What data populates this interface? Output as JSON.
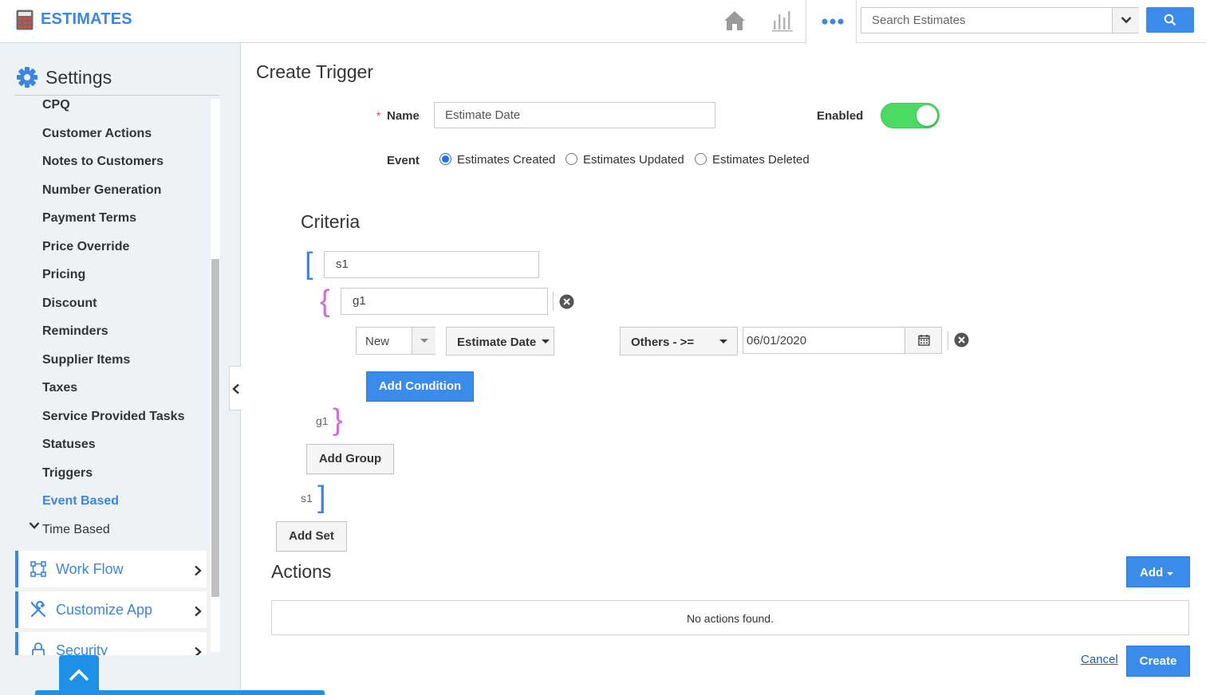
{
  "header": {
    "app_title": "ESTIMATES",
    "search_placeholder": "Search Estimates",
    "icons": [
      "calculator-icon",
      "home-icon",
      "bar-chart-icon",
      "more-dots-icon",
      "chevron-down-icon",
      "search-icon"
    ]
  },
  "colors": {
    "accent": "#3b86e0",
    "primary_button": "#3b8beb",
    "toggle_on": "#4cd964",
    "group_bracket": "#cf6fd6",
    "required": "#e04a3b"
  },
  "sidebar": {
    "title": "Settings",
    "items": [
      {
        "label": "CPQ"
      },
      {
        "label": "Customer Actions"
      },
      {
        "label": "Notes to Customers"
      },
      {
        "label": "Number Generation"
      },
      {
        "label": "Payment Terms"
      },
      {
        "label": "Price Override"
      },
      {
        "label": "Pricing"
      },
      {
        "label": "Discount"
      },
      {
        "label": "Reminders"
      },
      {
        "label": "Supplier Items"
      },
      {
        "label": "Taxes"
      },
      {
        "label": "Service Provided Tasks"
      },
      {
        "label": "Statuses"
      },
      {
        "label": "Triggers"
      },
      {
        "label": "Event Based"
      },
      {
        "label": "Time Based"
      }
    ],
    "sections": [
      {
        "label": "Work Flow",
        "icon": "workflow-icon"
      },
      {
        "label": "Customize App",
        "icon": "tools-icon"
      },
      {
        "label": "Security",
        "icon": "lock-icon"
      }
    ]
  },
  "main": {
    "title": "Create Trigger",
    "name_label": "Name",
    "required_mark": "*",
    "name_value": "Estimate Date",
    "enabled_label": "Enabled",
    "enabled": true,
    "event_label": "Event",
    "events": [
      {
        "label": "Estimates Created",
        "checked": true
      },
      {
        "label": "Estimates Updated",
        "checked": false
      },
      {
        "label": "Estimates Deleted",
        "checked": false
      }
    ],
    "criteria": {
      "title": "Criteria",
      "set_open": "[",
      "set_close": "]",
      "group_open": "{",
      "group_close": "}",
      "set_name": "s1",
      "group_name": "g1",
      "condition": {
        "source": "New",
        "field": "Estimate Date",
        "operator": "Others - >=",
        "value": "06/01/2020"
      },
      "add_condition": "Add Condition",
      "add_group": "Add Group",
      "add_set": "Add Set"
    },
    "actions": {
      "title": "Actions",
      "add_label": "Add",
      "empty_text": "No actions found."
    },
    "cancel_label": "Cancel",
    "create_label": "Create"
  }
}
